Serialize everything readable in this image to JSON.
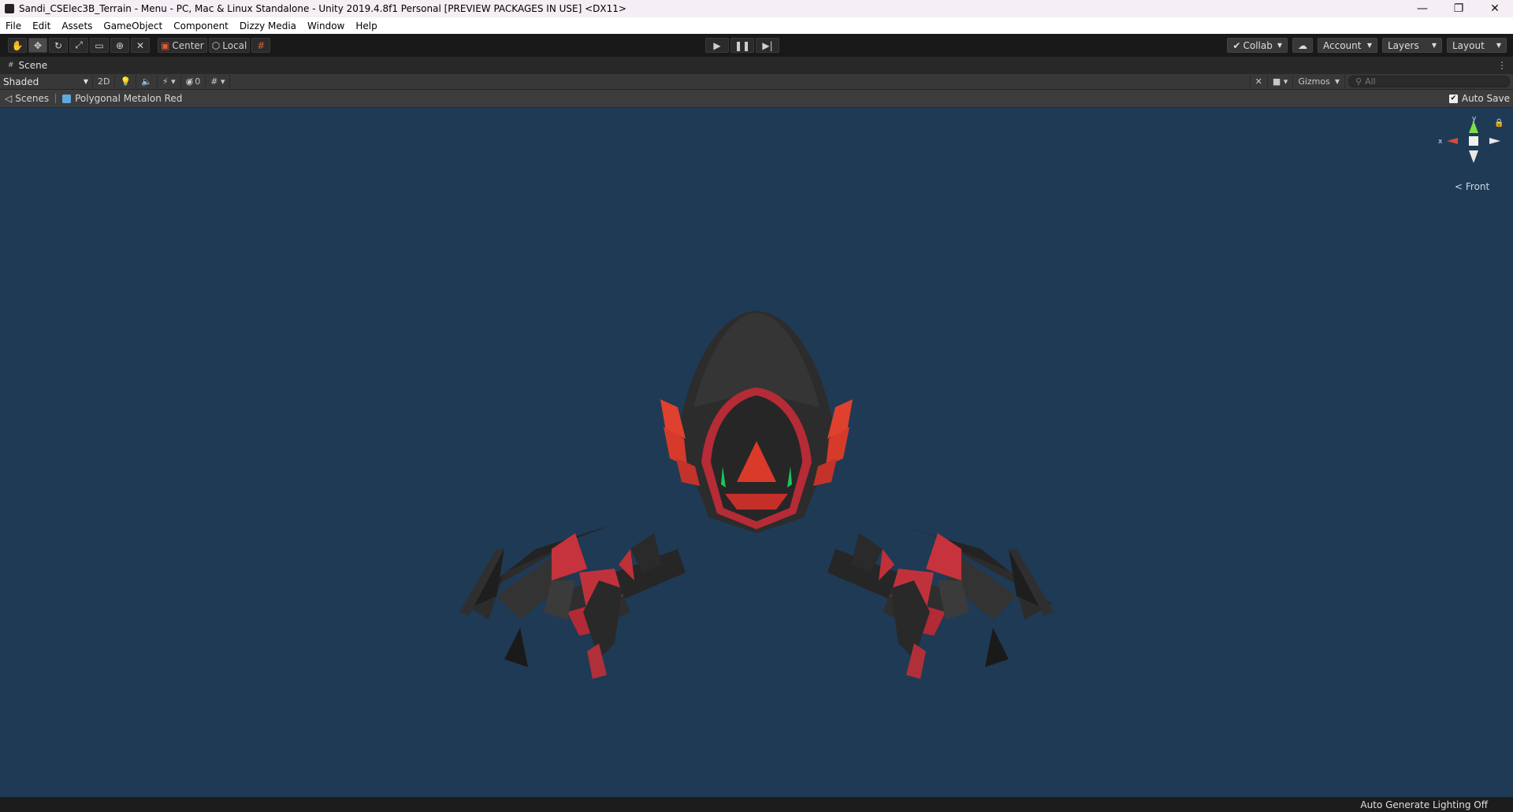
{
  "window": {
    "title": "Sandi_CSElec3B_Terrain - Menu - PC, Mac & Linux Standalone - Unity 2019.4.8f1 Personal [PREVIEW PACKAGES IN USE] <DX11>",
    "minimize": "—",
    "maximize": "❐",
    "close": "✕"
  },
  "menu": [
    "File",
    "Edit",
    "Assets",
    "GameObject",
    "Component",
    "Dizzy Media",
    "Window",
    "Help"
  ],
  "toolbar": {
    "pivot_mode": "Center",
    "pivot_rotation": "Local",
    "collab": "Collab",
    "account": "Account",
    "layers": "Layers",
    "layout": "Layout"
  },
  "scene_tab": {
    "label": "Scene"
  },
  "scene_toolbar": {
    "shading": "Shaded",
    "mode_2d": "2D",
    "hidden_count": "0",
    "gizmos": "Gizmos",
    "search_placeholder": "All"
  },
  "breadcrumb": {
    "scenes": "Scenes",
    "prefab": "Polygonal Metalon Red",
    "auto_save": "Auto Save",
    "auto_save_checked": true
  },
  "gizmo": {
    "view": "Front",
    "y_label": "y",
    "x_label": "x"
  },
  "status": {
    "text": "Auto Generate Lighting Off"
  },
  "colors": {
    "viewport_bg": "#1f3a55",
    "model_body": "#2b2b2b",
    "model_accent": "#d93a2a"
  }
}
